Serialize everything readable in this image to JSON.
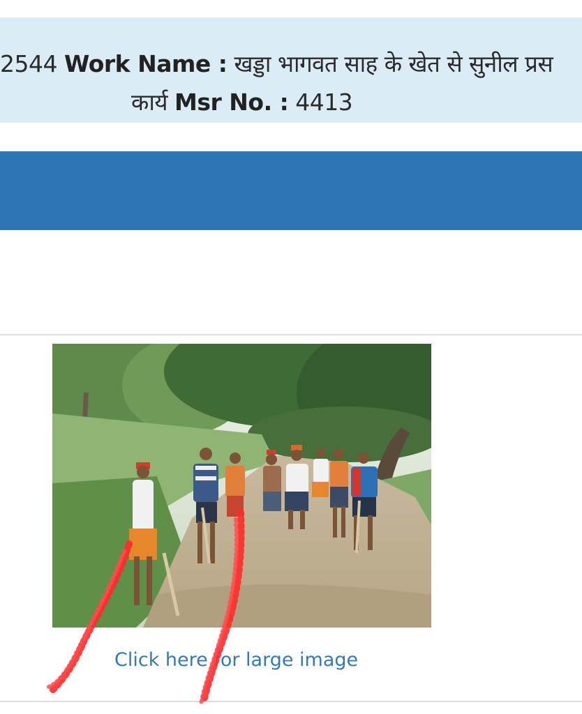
{
  "header": {
    "work_code_fragment": "2544",
    "work_name_label": "Work Name :",
    "work_name_value": "खड्डा भागवत साह के खेत से सुनील प्रस",
    "work_name_tail": "कार्य",
    "msr_label": "Msr No. :",
    "msr_value": "4413"
  },
  "photo": {
    "alt": "Workers standing with spades on a dirt path under trees",
    "link_label": "Click here for large image"
  },
  "colors": {
    "info_band": "#dcecf6",
    "blue_bar": "#2f74b4",
    "link": "#337ab7",
    "annotation": "#ff2a2a"
  }
}
